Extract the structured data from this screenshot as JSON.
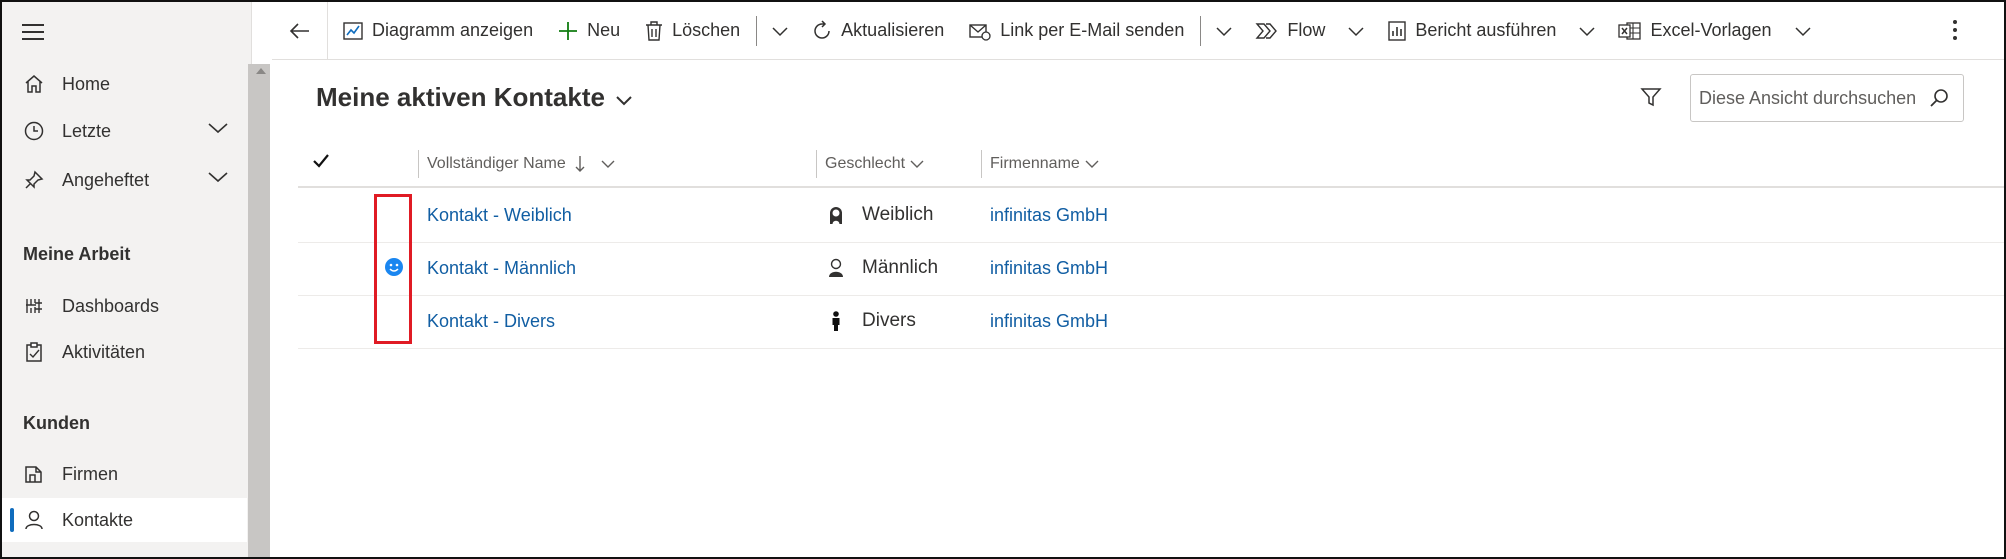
{
  "sidebar": {
    "items_top": [
      {
        "label": "Home",
        "icon": "home-icon"
      },
      {
        "label": "Letzte",
        "icon": "clock-icon",
        "expandable": true
      },
      {
        "label": "Angeheftet",
        "icon": "pin-icon",
        "expandable": true
      }
    ],
    "section_work": "Meine Arbeit",
    "items_work": [
      {
        "label": "Dashboards",
        "icon": "dashboard-icon"
      },
      {
        "label": "Aktivitäten",
        "icon": "clipboard-icon"
      }
    ],
    "section_customers": "Kunden",
    "items_customers": [
      {
        "label": "Firmen",
        "icon": "building-icon"
      },
      {
        "label": "Kontakte",
        "icon": "person-icon",
        "active": true
      }
    ]
  },
  "toolbar": {
    "chart": "Diagramm anzeigen",
    "new": "Neu",
    "delete": "Löschen",
    "refresh": "Aktualisieren",
    "email_link": "Link per E-Mail senden",
    "flow": "Flow",
    "report": "Bericht ausführen",
    "excel": "Excel-Vorlagen"
  },
  "view": {
    "title": "Meine aktiven Kontakte",
    "search_placeholder": "Diese Ansicht durchsuchen"
  },
  "grid": {
    "columns": {
      "name": "Vollständiger Name",
      "gender": "Geschlecht",
      "company": "Firmenname"
    },
    "rows": [
      {
        "name": "Kontakt - Weiblich",
        "gender": "Weiblich",
        "gender_icon": "female-icon",
        "company": "infinitas GmbH",
        "status": ""
      },
      {
        "name": "Kontakt - Männlich",
        "gender": "Männlich",
        "gender_icon": "male-icon",
        "company": "infinitas GmbH",
        "status": "smiley-icon"
      },
      {
        "name": "Kontakt - Divers",
        "gender": "Divers",
        "gender_icon": "diverse-icon",
        "company": "infinitas GmbH",
        "status": ""
      }
    ]
  },
  "colors": {
    "accent": "#0f6cbd",
    "link": "#115ea3",
    "highlight": "#e01b24",
    "status_blue": "#1a86f0"
  }
}
